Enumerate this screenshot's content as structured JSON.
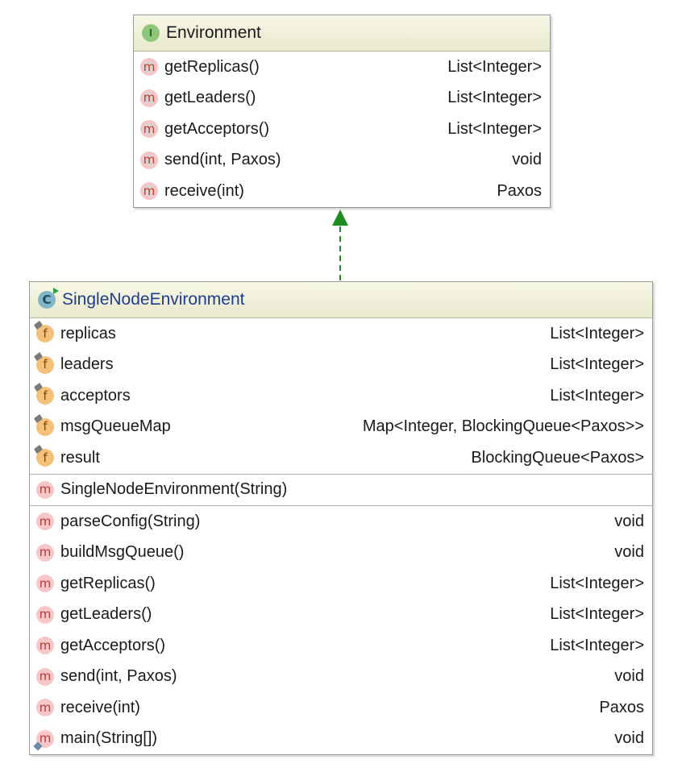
{
  "interface": {
    "stereotype_letter": "I",
    "name": "Environment",
    "methods": [
      {
        "icon": "m",
        "name": "getReplicas()",
        "type": "List<Integer>"
      },
      {
        "icon": "m",
        "name": "getLeaders()",
        "type": "List<Integer>"
      },
      {
        "icon": "m",
        "name": "getAcceptors()",
        "type": "List<Integer>"
      },
      {
        "icon": "m",
        "name": "send(int, Paxos)",
        "type": "void"
      },
      {
        "icon": "m",
        "name": "receive(int)",
        "type": "Paxos"
      }
    ]
  },
  "class": {
    "stereotype_letter": "C",
    "name": "SingleNodeEnvironment",
    "fields": [
      {
        "icon": "f",
        "name": "replicas",
        "type": "List<Integer>"
      },
      {
        "icon": "f",
        "name": "leaders",
        "type": "List<Integer>"
      },
      {
        "icon": "f",
        "name": "acceptors",
        "type": "List<Integer>"
      },
      {
        "icon": "f",
        "name": "msgQueueMap",
        "type": "Map<Integer, BlockingQueue<Paxos>>"
      },
      {
        "icon": "f",
        "name": "result",
        "type": "BlockingQueue<Paxos>"
      }
    ],
    "constructors": [
      {
        "icon": "m",
        "name": "SingleNodeEnvironment(String)",
        "type": ""
      }
    ],
    "methods": [
      {
        "icon": "m",
        "name": "parseConfig(String)",
        "type": "void"
      },
      {
        "icon": "m",
        "name": "buildMsgQueue()",
        "type": "void"
      },
      {
        "icon": "m",
        "name": "getReplicas()",
        "type": "List<Integer>"
      },
      {
        "icon": "m",
        "name": "getLeaders()",
        "type": "List<Integer>"
      },
      {
        "icon": "m",
        "name": "getAcceptors()",
        "type": "List<Integer>"
      },
      {
        "icon": "m",
        "name": "send(int, Paxos)",
        "type": "void"
      },
      {
        "icon": "m",
        "name": "receive(int)",
        "type": "Paxos"
      },
      {
        "icon": "m",
        "name": "main(String[])",
        "type": "void"
      }
    ]
  },
  "relation": {
    "kind": "realization",
    "color": "#1f8a1f"
  }
}
